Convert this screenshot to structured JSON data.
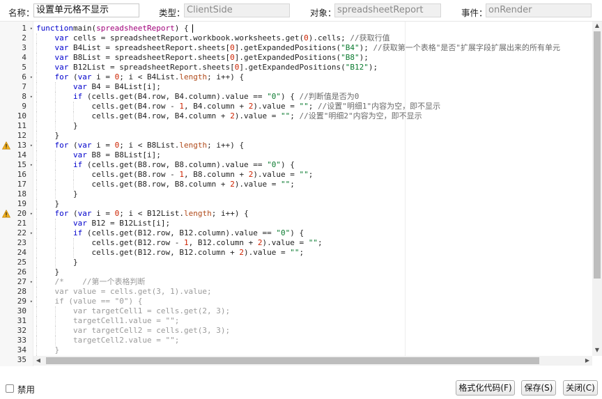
{
  "form": {
    "name_label": "名称：",
    "name_value": "设置单元格不显示",
    "type_label": "类型：",
    "type_value": "ClientSide",
    "object_label": "对象：",
    "object_value": "spreadsheetReport",
    "event_label": "事件：",
    "event_value": "onRender"
  },
  "editor": {
    "warning_lines": [
      13,
      20
    ],
    "fold_lines": [
      1,
      6,
      8,
      13,
      15,
      20,
      22,
      27,
      29
    ],
    "lines": [
      [
        [
          0,
          "kw",
          "function"
        ],
        [
          0,
          "",
          "main("
        ],
        [
          0,
          "param",
          "spreadsheetReport"
        ],
        [
          0,
          "",
          ") {"
        ]
      ],
      [
        [
          1,
          "kw",
          "var"
        ],
        [
          1,
          "",
          " cells = spreadsheetReport.workbook.worksheets.get("
        ],
        [
          1,
          "num",
          "0"
        ],
        [
          1,
          "",
          ").cells; "
        ],
        [
          1,
          "cm",
          "//获取行值"
        ]
      ],
      [
        [
          1,
          "kw",
          "var"
        ],
        [
          1,
          "",
          " B4List = spreadsheetReport.sheets["
        ],
        [
          1,
          "num",
          "0"
        ],
        [
          1,
          "",
          "].getExpandedPositions("
        ],
        [
          1,
          "str",
          "\"B4\""
        ],
        [
          1,
          "",
          "); "
        ],
        [
          1,
          "cm",
          "//获取第一个表格\"是否\"扩展字段扩展出来的所有单元"
        ]
      ],
      [
        [
          1,
          "kw",
          "var"
        ],
        [
          1,
          "",
          " B8List = spreadsheetReport.sheets["
        ],
        [
          1,
          "num",
          "0"
        ],
        [
          1,
          "",
          "].getExpandedPositions("
        ],
        [
          1,
          "str",
          "\"B8\""
        ],
        [
          1,
          "",
          ");"
        ]
      ],
      [
        [
          1,
          "kw",
          "var"
        ],
        [
          1,
          "",
          " B12List = spreadsheetReport.sheets["
        ],
        [
          1,
          "num",
          "0"
        ],
        [
          1,
          "",
          "].getExpandedPositions("
        ],
        [
          1,
          "str",
          "\"B12\""
        ],
        [
          1,
          "",
          ");"
        ]
      ],
      [
        [
          1,
          "kw",
          "for"
        ],
        [
          1,
          "",
          " ("
        ],
        [
          1,
          "kw",
          "var"
        ],
        [
          1,
          "",
          " i = "
        ],
        [
          1,
          "num",
          "0"
        ],
        [
          1,
          "",
          "; i < B4List."
        ],
        [
          1,
          "prop",
          "length"
        ],
        [
          1,
          "",
          "; i++) {"
        ]
      ],
      [
        [
          2,
          "kw",
          "var"
        ],
        [
          2,
          "",
          " B4 = B4List[i];"
        ]
      ],
      [
        [
          2,
          "kw",
          "if"
        ],
        [
          2,
          "",
          " (cells.get(B4.row, B4.column).value == "
        ],
        [
          2,
          "str",
          "\"0\""
        ],
        [
          2,
          "",
          ") { "
        ],
        [
          2,
          "cm",
          "//判断值是否为0"
        ]
      ],
      [
        [
          3,
          "",
          ""
        ],
        [
          3,
          "",
          "cells.get(B4.row - "
        ],
        [
          3,
          "num",
          "1"
        ],
        [
          3,
          "",
          ", B4.column + "
        ],
        [
          3,
          "num",
          "2"
        ],
        [
          3,
          "",
          ").value = "
        ],
        [
          3,
          "str",
          "\"\""
        ],
        [
          3,
          "",
          "; "
        ],
        [
          3,
          "cm",
          "//设置\"明细1\"内容为空，即不显示"
        ]
      ],
      [
        [
          3,
          "",
          ""
        ],
        [
          3,
          "",
          "cells.get(B4.row, B4.column + "
        ],
        [
          3,
          "num",
          "2"
        ],
        [
          3,
          "",
          ").value = "
        ],
        [
          3,
          "str",
          "\"\""
        ],
        [
          3,
          "",
          "; "
        ],
        [
          3,
          "cm",
          "//设置\"明细2\"内容为空，即不显示"
        ]
      ],
      [
        [
          2,
          "",
          "}"
        ]
      ],
      [
        [
          1,
          "",
          "}"
        ]
      ],
      [
        [
          1,
          "kw",
          "for"
        ],
        [
          1,
          "",
          " ("
        ],
        [
          1,
          "kw",
          "var"
        ],
        [
          1,
          "",
          " i = "
        ],
        [
          1,
          "num",
          "0"
        ],
        [
          1,
          "",
          "; i < B8List."
        ],
        [
          1,
          "prop",
          "length"
        ],
        [
          1,
          "",
          "; i++) {"
        ]
      ],
      [
        [
          2,
          "kw",
          "var"
        ],
        [
          2,
          "",
          " B8 = B8List[i];"
        ]
      ],
      [
        [
          2,
          "kw",
          "if"
        ],
        [
          2,
          "",
          " (cells.get(B8.row, B8.column).value == "
        ],
        [
          2,
          "str",
          "\"0\""
        ],
        [
          2,
          "",
          ") {"
        ]
      ],
      [
        [
          3,
          "",
          ""
        ],
        [
          3,
          "",
          "cells.get(B8.row - "
        ],
        [
          3,
          "num",
          "1"
        ],
        [
          3,
          "",
          ", B8.column + "
        ],
        [
          3,
          "num",
          "2"
        ],
        [
          3,
          "",
          ").value = "
        ],
        [
          3,
          "str",
          "\"\""
        ],
        [
          3,
          "",
          ";"
        ]
      ],
      [
        [
          3,
          "",
          ""
        ],
        [
          3,
          "",
          "cells.get(B8.row, B8.column + "
        ],
        [
          3,
          "num",
          "2"
        ],
        [
          3,
          "",
          ").value = "
        ],
        [
          3,
          "str",
          "\"\""
        ],
        [
          3,
          "",
          ";"
        ]
      ],
      [
        [
          2,
          "",
          "}"
        ]
      ],
      [
        [
          1,
          "",
          "}"
        ]
      ],
      [
        [
          1,
          "kw",
          "for"
        ],
        [
          1,
          "",
          " ("
        ],
        [
          1,
          "kw",
          "var"
        ],
        [
          1,
          "",
          " i = "
        ],
        [
          1,
          "num",
          "0"
        ],
        [
          1,
          "",
          "; i < B12List."
        ],
        [
          1,
          "prop",
          "length"
        ],
        [
          1,
          "",
          "; i++) {"
        ]
      ],
      [
        [
          2,
          "kw",
          "var"
        ],
        [
          2,
          "",
          " B12 = B12List[i];"
        ]
      ],
      [
        [
          2,
          "kw",
          "if"
        ],
        [
          2,
          "",
          " (cells.get(B12.row, B12.column).value == "
        ],
        [
          2,
          "str",
          "\"0\""
        ],
        [
          2,
          "",
          ") {"
        ]
      ],
      [
        [
          3,
          "",
          ""
        ],
        [
          3,
          "",
          "cells.get(B12.row - "
        ],
        [
          3,
          "num",
          "1"
        ],
        [
          3,
          "",
          ", B12.column + "
        ],
        [
          3,
          "num",
          "2"
        ],
        [
          3,
          "",
          ").value = "
        ],
        [
          3,
          "str",
          "\"\""
        ],
        [
          3,
          "",
          ";"
        ]
      ],
      [
        [
          3,
          "",
          ""
        ],
        [
          3,
          "",
          "cells.get(B12.row, B12.column + "
        ],
        [
          3,
          "num",
          "2"
        ],
        [
          3,
          "",
          ").value = "
        ],
        [
          3,
          "str",
          "\"\""
        ],
        [
          3,
          "",
          ";"
        ]
      ],
      [
        [
          2,
          "",
          "}"
        ]
      ],
      [
        [
          1,
          "",
          "}"
        ]
      ],
      [
        [
          1,
          "mute",
          "/*    //第一个表格判断"
        ]
      ],
      [
        [
          1,
          "mute",
          "var value = cells.get(3, 1).value;"
        ]
      ],
      [
        [
          1,
          "mute",
          "if (value == \"0\") {"
        ]
      ],
      [
        [
          2,
          "mute",
          "var targetCell1 = cells.get(2, 3);"
        ]
      ],
      [
        [
          2,
          "mute",
          "targetCell1.value = \"\";"
        ]
      ],
      [
        [
          2,
          "mute",
          "var targetCell2 = cells.get(3, 3);"
        ]
      ],
      [
        [
          2,
          "mute",
          "targetCell2.value = \"\";"
        ]
      ],
      [
        [
          1,
          "mute",
          "}"
        ]
      ],
      [
        [
          1,
          "mute",
          ""
        ]
      ]
    ]
  },
  "footer": {
    "disable_label": "禁用",
    "format_button": "格式化代码(F)",
    "save_button": "保存(S)",
    "close_button": "关闭(C)"
  }
}
